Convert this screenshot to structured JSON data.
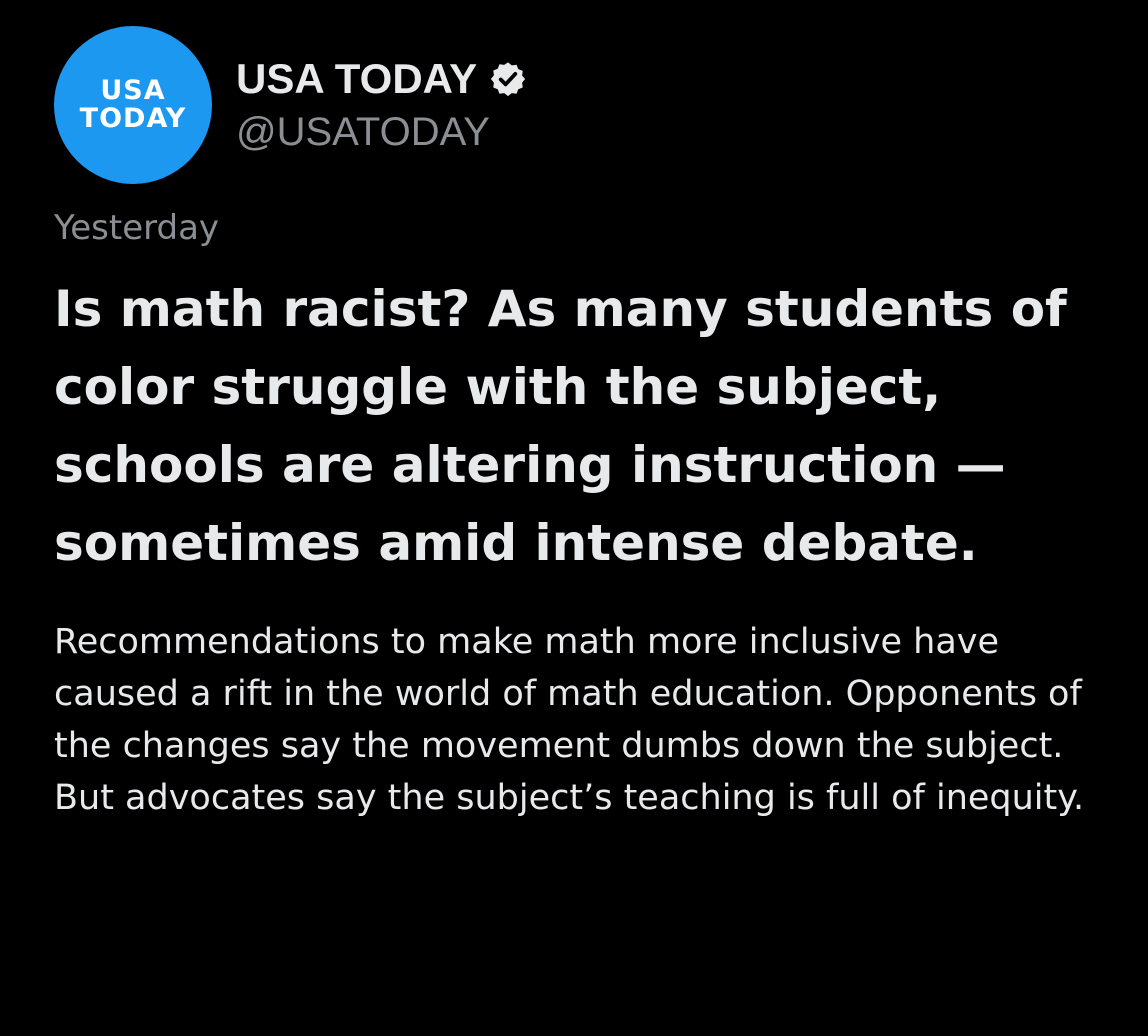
{
  "account": {
    "avatar_line1": "USA",
    "avatar_line2": "TODAY",
    "display_name": "USA TODAY",
    "handle": "@USATODAY",
    "verified_icon": "verified-badge-icon"
  },
  "tweet": {
    "timestamp": "Yesterday",
    "headline": "Is math racist? As many students of color struggle with the subject, schools are altering instruction —  sometimes amid intense debate.",
    "description": "Recommendations to make math more inclusive have caused a rift in the world of math education. Opponents of the changes say the movement dumbs down the subject. But advocates say the subject’s teaching is full of inequity."
  },
  "colors": {
    "background": "#000000",
    "avatar": "#1d98f0",
    "primary_text": "#e7e9ea",
    "secondary_text": "#8b8f94"
  }
}
